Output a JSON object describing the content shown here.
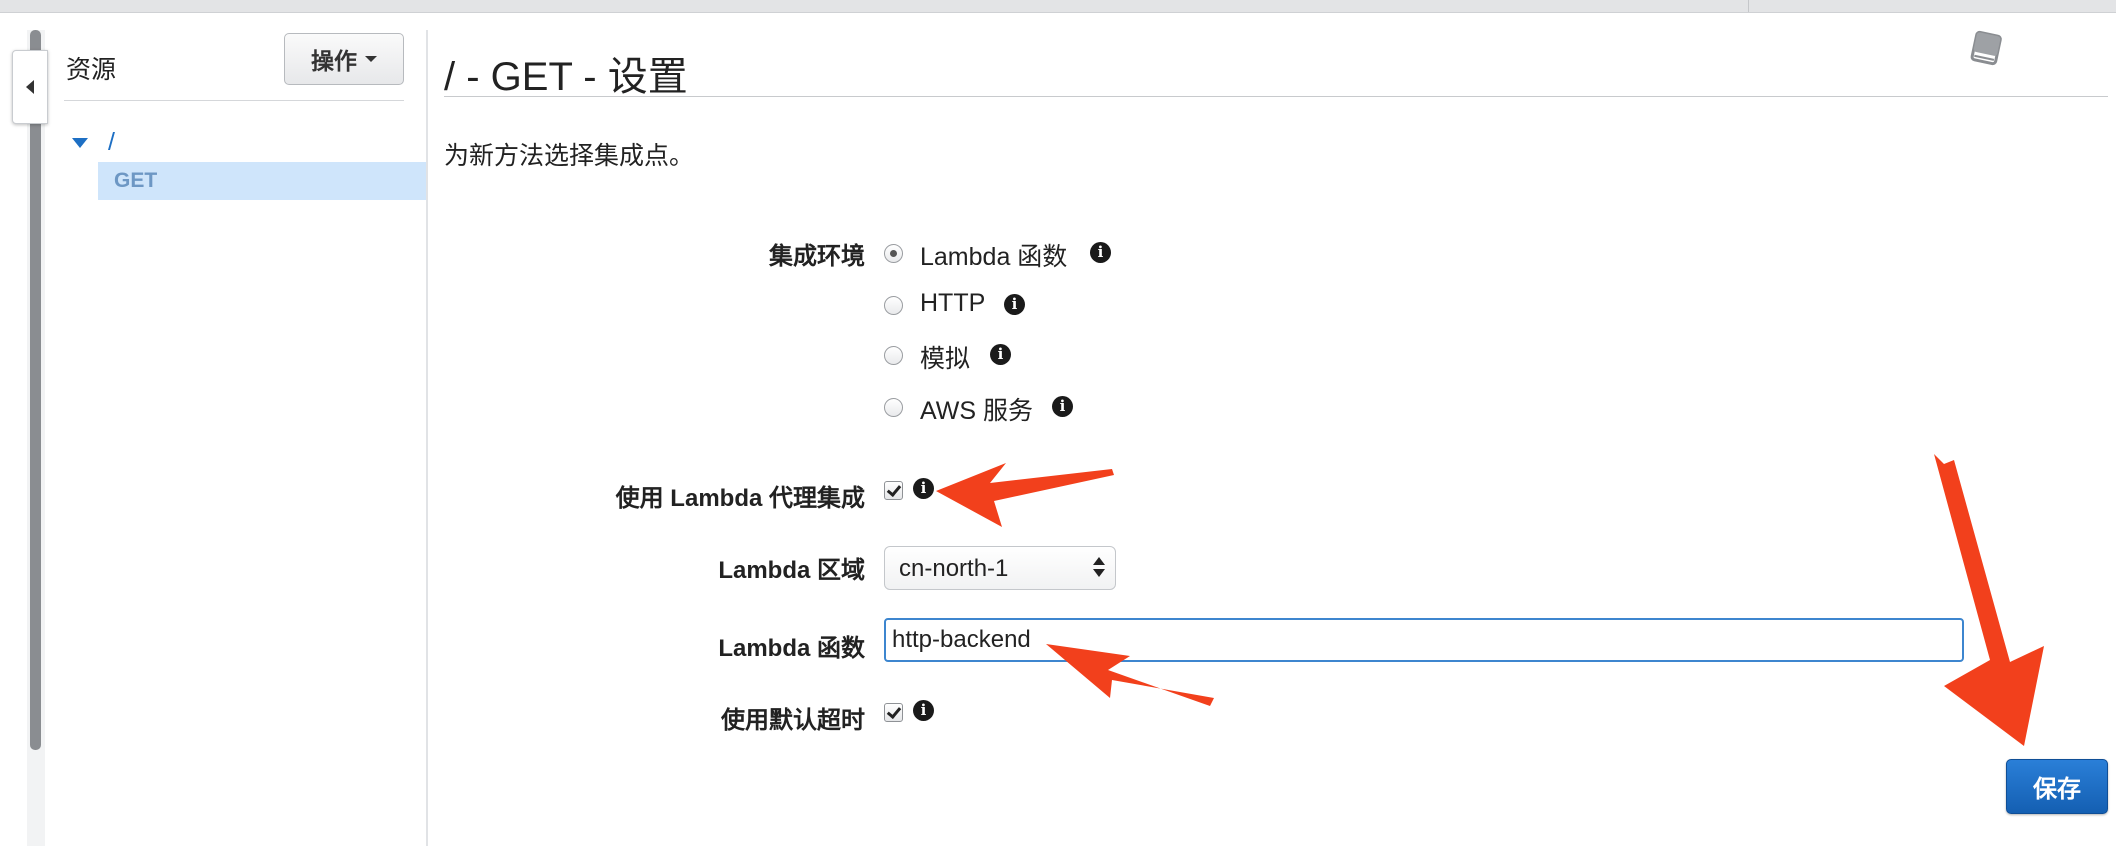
{
  "sidebar": {
    "title": "资源",
    "actions_label": "操作",
    "tree": {
      "root": "/",
      "child": "GET"
    }
  },
  "main": {
    "title": "/ - GET - 设置",
    "description": "为新方法选择集成点。",
    "integration_type": {
      "label": "集成环境",
      "options": [
        "Lambda 函数",
        "HTTP",
        "模拟",
        "AWS 服务"
      ],
      "selected": "Lambda 函数"
    },
    "proxy": {
      "label": "使用 Lambda 代理集成",
      "checked": true
    },
    "region": {
      "label": "Lambda 区域",
      "value": "cn-north-1"
    },
    "function": {
      "label": "Lambda 函数",
      "value": "http-backend"
    },
    "timeout": {
      "label": "使用默认超时",
      "checked": true
    },
    "save_label": "保存"
  },
  "colors": {
    "accent": "#1d6fc4",
    "save_button": "#1f6fc6",
    "arrow": "#f2401c",
    "tree_selected_bg": "#cfe5fb"
  }
}
